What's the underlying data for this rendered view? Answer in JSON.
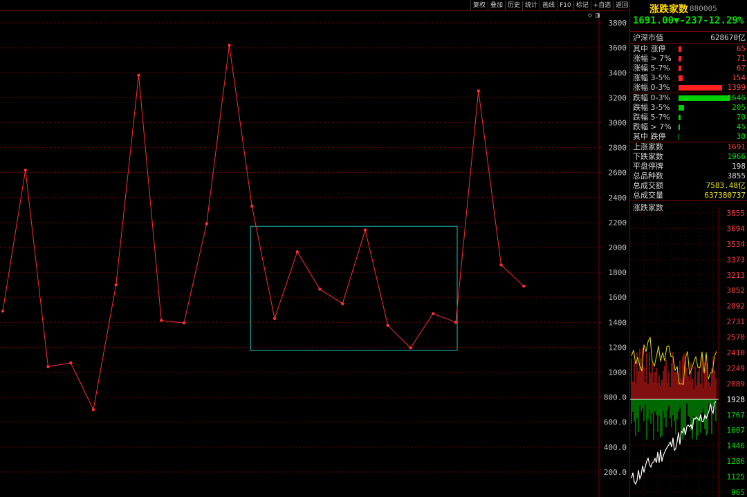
{
  "toolbar": {
    "buttons": [
      "复权",
      "叠加",
      "历史",
      "统计",
      "画线",
      "F10",
      "标记",
      "+自选",
      "返回"
    ]
  },
  "chart_data": {
    "type": "line",
    "ylim": [
      0,
      3900
    ],
    "y_ticks": [
      "200.0",
      "400.0",
      "600.0",
      "800.0",
      "1000",
      "1200",
      "1400",
      "1600",
      "1800",
      "2000",
      "2200",
      "2400",
      "2600",
      "2800",
      "3000",
      "3200",
      "3400",
      "3600",
      "3800"
    ],
    "y_tick_values": [
      200,
      400,
      600,
      800,
      1000,
      1200,
      1400,
      1600,
      1800,
      2000,
      2200,
      2400,
      2600,
      2800,
      3000,
      3200,
      3400,
      3600,
      3800
    ],
    "series": [
      {
        "values": [
          1490,
          2620,
          1045,
          1075,
          700,
          1700,
          3380,
          1415,
          1395,
          2190,
          3620,
          2330,
          1430,
          1965,
          1665,
          1550,
          2140,
          1375,
          1195,
          1470,
          1400,
          3255,
          1860,
          1690
        ]
      }
    ],
    "highlight_box": {
      "x_start": 11,
      "x_end": 20,
      "y_low": 1175,
      "y_high": 2170
    },
    "colors": {
      "line": "#ff3030",
      "box": "#20c0c0",
      "grid": "#6a0000",
      "axis_text": "#c0c0c0"
    }
  },
  "panel": {
    "title": "涨跌家数",
    "code": "880005",
    "price": "1691.00",
    "arrow": "▼",
    "change": "-237",
    "change_pct": "-12.29%",
    "market_cap_label": "沪深市值",
    "market_cap_value": "628670亿",
    "up_rows": [
      {
        "label": "其中 涨停",
        "value": "65",
        "bar": 4
      },
      {
        "label": "涨幅 > 7%",
        "value": "71",
        "bar": 4
      },
      {
        "label": "涨幅 5-7%",
        "value": "67",
        "bar": 4
      },
      {
        "label": "涨幅 3-5%",
        "value": "154",
        "bar": 6
      },
      {
        "label": "涨幅 0-3%",
        "value": "1399",
        "bar": 63
      }
    ],
    "down_rows": [
      {
        "label": "跌幅 0-3%",
        "value": "1646",
        "bar": 74
      },
      {
        "label": "跌幅 3-5%",
        "value": "205",
        "bar": 8
      },
      {
        "label": "跌幅 5-7%",
        "value": "70",
        "bar": 3
      },
      {
        "label": "跌幅 > 7%",
        "value": "45",
        "bar": 2
      },
      {
        "label": "其中 跌停",
        "value": "30",
        "bar": 1
      }
    ],
    "summary_rows": [
      {
        "label": "上涨家数",
        "value": "1691",
        "color": "red"
      },
      {
        "label": "下跌家数",
        "value": "1966",
        "color": "green"
      },
      {
        "label": "平盘停牌",
        "value": "198",
        "color": "white"
      },
      {
        "label": "总品种数",
        "value": "3855",
        "color": "white"
      },
      {
        "label": "总成交额",
        "value": "7583.48亿",
        "color": "yellow"
      },
      {
        "label": "总成交量",
        "value": "637380737",
        "color": "yellow"
      }
    ],
    "mini_title": "涨跌家数",
    "mini_ticks": [
      "3855",
      "3694",
      "3534",
      "3373",
      "3213",
      "3052",
      "2892",
      "2731",
      "2570",
      "2410",
      "2249",
      "2089",
      "1928",
      "1767",
      "1607",
      "1446",
      "1286",
      "1125",
      "965"
    ],
    "mini_colors": {
      "up": "#ff2020",
      "down": "#00d000",
      "line": "#ffffff",
      "yellow": "#e0e000",
      "zero": "#ffffff"
    }
  }
}
